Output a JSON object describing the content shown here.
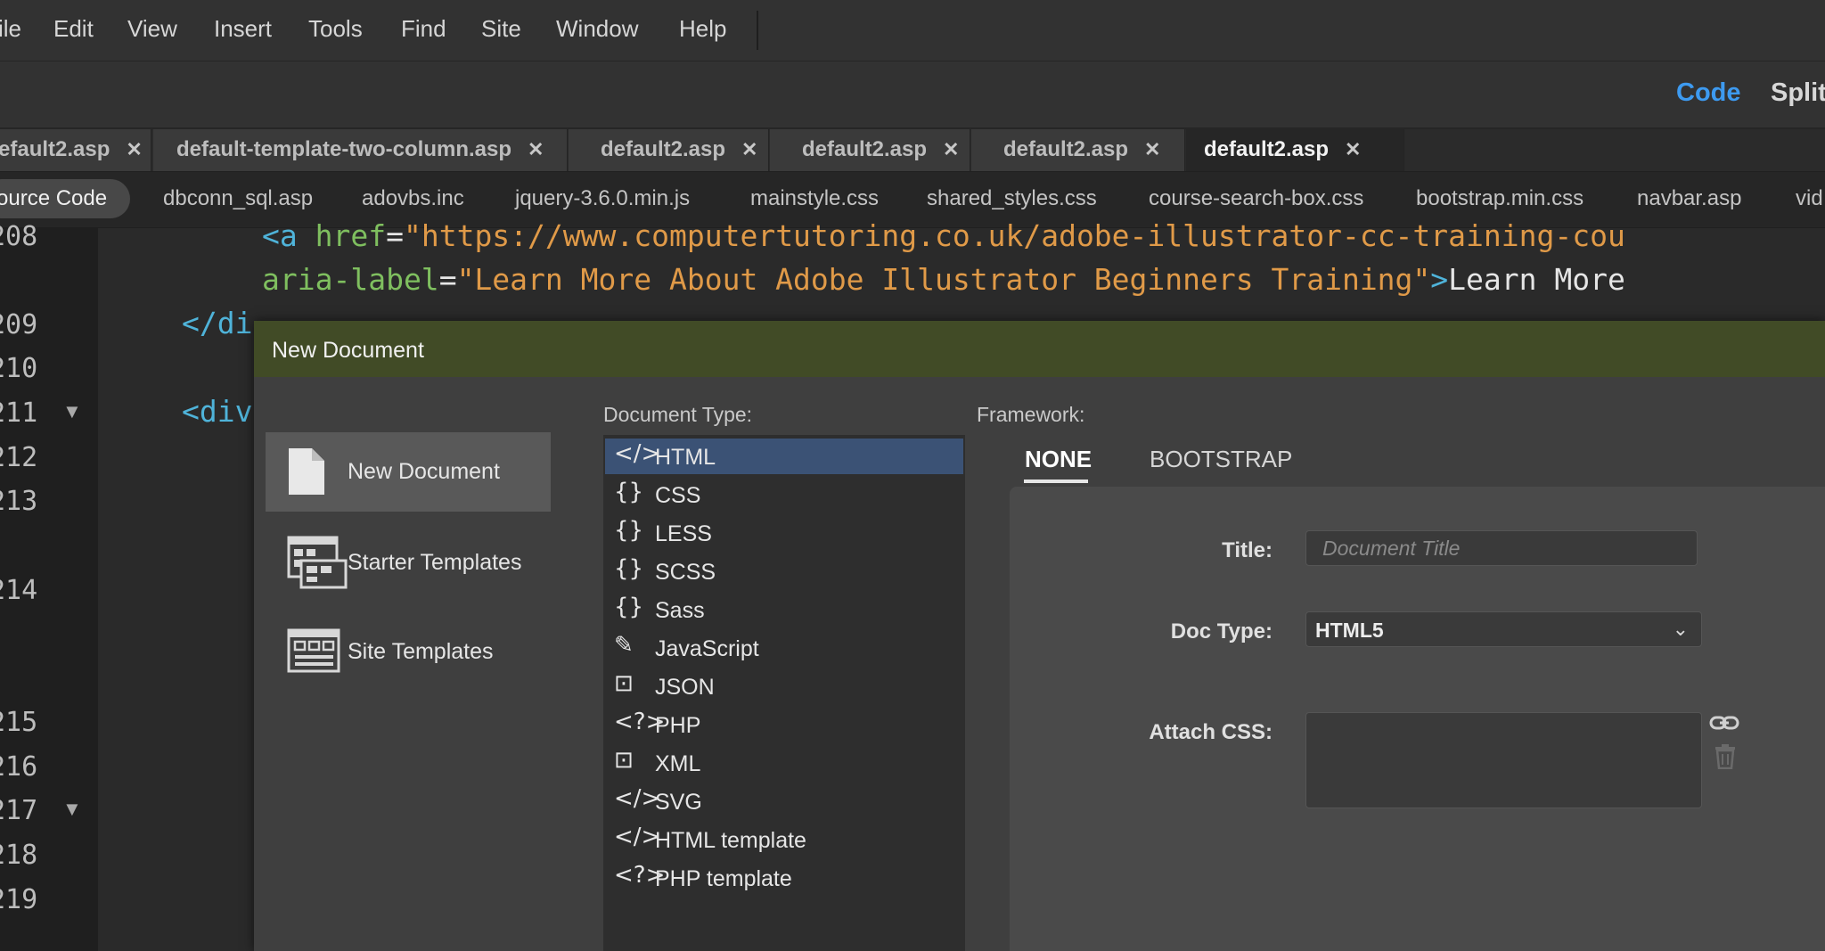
{
  "menu": [
    "ile",
    "Edit",
    "View",
    "Insert",
    "Tools",
    "Find",
    "Site",
    "Window",
    "Help"
  ],
  "view_modes": {
    "code": "Code",
    "split": "Split"
  },
  "tabs": [
    {
      "label": "efault2.asp",
      "close": "✕"
    },
    {
      "label": "default-template-two-column.asp",
      "close": "✕"
    },
    {
      "label": "default2.asp",
      "close": "✕"
    },
    {
      "label": "default2.asp",
      "close": "✕"
    },
    {
      "label": "default2.asp",
      "close": "✕"
    },
    {
      "label": "default2.asp",
      "close": "✕"
    }
  ],
  "related_files": [
    "ource Code",
    "dbconn_sql.asp",
    "adovbs.inc",
    "jquery-3.6.0.min.js",
    "mainstyle.css",
    "shared_styles.css",
    "course-search-box.css",
    "bootstrap.min.css",
    "navbar.asp",
    "vid"
  ],
  "line_numbers": [
    "208",
    "209",
    "210",
    "211",
    "212",
    "213",
    "214",
    "215",
    "216",
    "217",
    "218",
    "219"
  ],
  "code": {
    "l1_tag": "<a",
    "l1_attr": " href",
    "l1_eq": "=",
    "l1_str": "\"https://www.computertutoring.co.uk/adobe-illustrator-cc-training-cou",
    "l2_attr": "aria-label",
    "l2_eq": "=",
    "l2_str": "\"Learn More About Adobe Illustrator Beginners Training\"",
    "l2_tag": ">",
    "l2_txt": "Learn More",
    "l3_tag": "</di",
    "l5_tag": "<div"
  },
  "dialog": {
    "title": "New Document",
    "side": [
      "New Document",
      "Starter Templates",
      "Site Templates"
    ],
    "doc_type_label": "Document Type:",
    "framework_label": "Framework:",
    "doc_types": [
      {
        "icon": "</>",
        "label": "HTML"
      },
      {
        "icon": "{}",
        "label": "CSS"
      },
      {
        "icon": "{}",
        "label": "LESS"
      },
      {
        "icon": "{}",
        "label": "SCSS"
      },
      {
        "icon": "{}",
        "label": "Sass"
      },
      {
        "icon": "✎",
        "label": "JavaScript"
      },
      {
        "icon": "⊡",
        "label": "JSON"
      },
      {
        "icon": "<?>",
        "label": "PHP"
      },
      {
        "icon": "⊡",
        "label": "XML"
      },
      {
        "icon": "</>",
        "label": "SVG"
      },
      {
        "icon": "</>",
        "label": "HTML template"
      },
      {
        "icon": "<?>",
        "label": "PHP template"
      }
    ],
    "framework_tabs": [
      "NONE",
      "BOOTSTRAP"
    ],
    "title_label": "Title:",
    "title_placeholder": "Document Title",
    "doc_type_field_label": "Doc Type:",
    "doc_type_value": "HTML5",
    "attach_css_label": "Attach CSS:"
  }
}
